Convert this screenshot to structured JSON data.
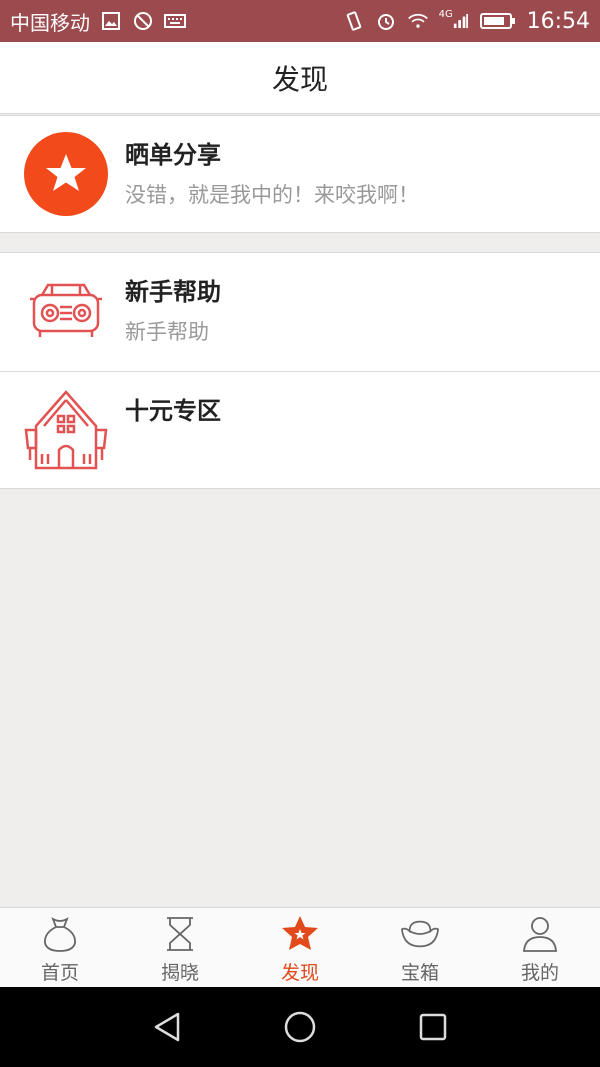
{
  "status_bar": {
    "carrier": "中国移动",
    "time": "16:54",
    "network": "4G",
    "icons": [
      "image-icon",
      "no-disturb-icon",
      "keyboard-icon",
      "vibrate-icon",
      "alarm-icon",
      "wifi-icon",
      "signal-icon",
      "battery-icon"
    ]
  },
  "header": {
    "title": "发现"
  },
  "sections": {
    "share": {
      "title": "晒单分享",
      "subtitle": "没错，就是我中的！来咬我啊！",
      "icon": "star-icon",
      "icon_color": "#f24a1b"
    },
    "help": {
      "title": "新手帮助",
      "subtitle": "新手帮助",
      "icon": "car-icon",
      "icon_color": "#e25252"
    },
    "ten_yuan": {
      "title": "十元专区",
      "icon": "house-icon",
      "icon_color": "#e25252"
    }
  },
  "bottom_nav": {
    "items": [
      {
        "label": "首页",
        "icon": "money-bag-icon"
      },
      {
        "label": "揭晓",
        "icon": "hourglass-icon"
      },
      {
        "label": "发现",
        "icon": "star-badge-icon",
        "active": true
      },
      {
        "label": "宝箱",
        "icon": "ingot-icon"
      },
      {
        "label": "我的",
        "icon": "user-icon"
      }
    ],
    "active_color": "#e24a1c",
    "inactive_color": "#666666"
  },
  "system_nav": {
    "icons": [
      "back-icon",
      "home-icon",
      "recents-icon"
    ]
  }
}
